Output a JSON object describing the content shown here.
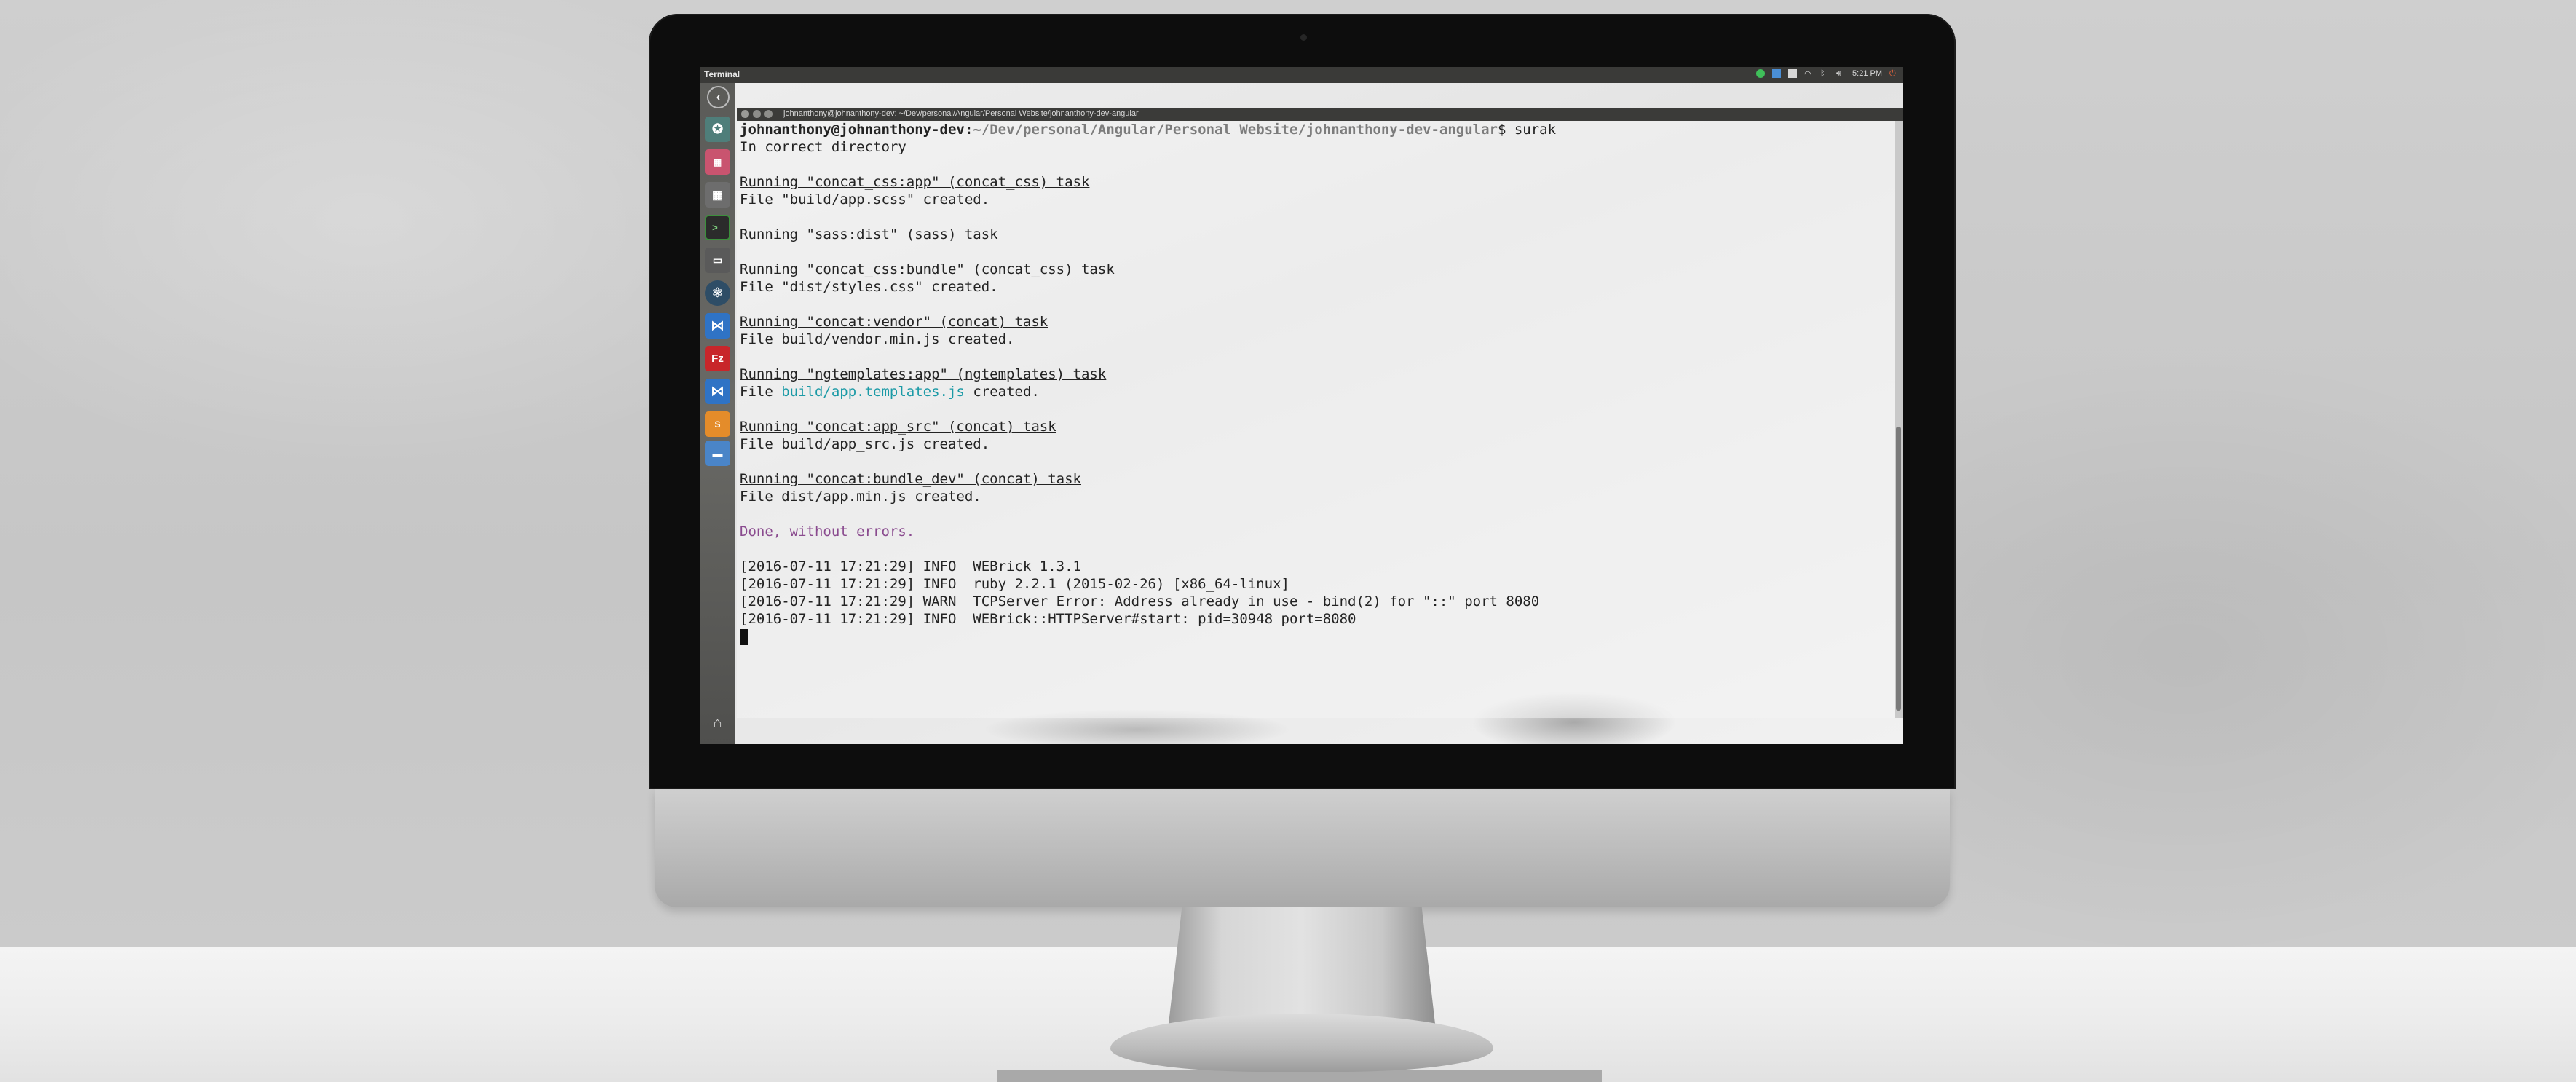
{
  "panel": {
    "title": "Terminal",
    "clock": "5:21 PM"
  },
  "window": {
    "title": "johnanthony@johnanthony-dev: ~/Dev/personal/Angular/Personal Website/johnanthony-dev-angular"
  },
  "launcher": {
    "icons": [
      "back-icon",
      "chrome-icon",
      "web-app-icon",
      "calculator-icon",
      "terminal-icon",
      "drive-icon",
      "atom-icon",
      "vscode-icon",
      "filezilla-icon",
      "vscode-icon",
      "sublime-icon",
      "files-icon",
      "trash-icon"
    ]
  },
  "terminal": {
    "prompt_user": "johnanthony@johnanthony-dev",
    "prompt_sep": ":",
    "prompt_path": "~/Dev/personal/Angular/Personal Website/johnanthony-dev-angular",
    "prompt_cmd": "$ surak",
    "l1": "In correct directory",
    "t1": "Running \"concat_css:app\" (concat_css) task",
    "r1": "File \"build/app.scss\" created.",
    "t2": "Running \"sass:dist\" (sass) task",
    "t3": "Running \"concat_css:bundle\" (concat_css) task",
    "r3": "File \"dist/styles.css\" created.",
    "t4": "Running \"concat:vendor\" (concat) task",
    "r4": "File build/vendor.min.js created.",
    "t5": "Running \"ngtemplates:app\" (ngtemplates) task",
    "r5a": "File ",
    "r5b": "build/app.templates.js",
    "r5c": " created.",
    "t6": "Running \"concat:app_src\" (concat) task",
    "r6": "File build/app_src.js created.",
    "t7": "Running \"concat:bundle_dev\" (concat) task",
    "r7": "File dist/app.min.js created.",
    "done": "Done, without errors.",
    "log1": "[2016-07-11 17:21:29] INFO  WEBrick 1.3.1",
    "log2": "[2016-07-11 17:21:29] INFO  ruby 2.2.1 (2015-02-26) [x86_64-linux]",
    "log3": "[2016-07-11 17:21:29] WARN  TCPServer Error: Address already in use - bind(2) for \"::\" port 8080",
    "log4": "[2016-07-11 17:21:29] INFO  WEBrick::HTTPServer#start: pid=30948 port=8080"
  },
  "colors": {
    "teal": "#1b9aa6",
    "purple": "#8a4b8f",
    "topbar": "#3a3a38"
  }
}
